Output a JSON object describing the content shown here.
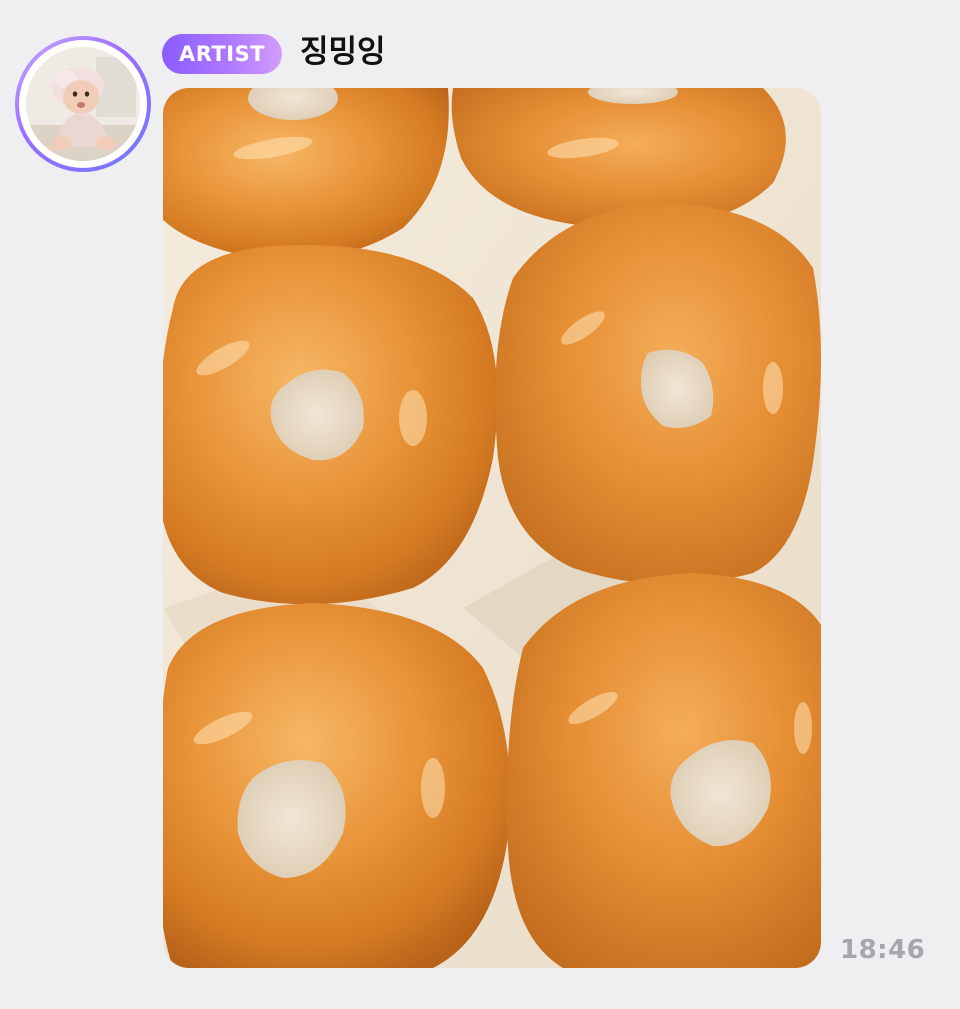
{
  "message": {
    "badge_label": "ARTIST",
    "sender_name": "징밍잉",
    "timestamp": "18:46",
    "avatar": {
      "icon": "baby-photo-avatar"
    },
    "attachment": {
      "type": "photo",
      "subject": "glazed-donuts"
    }
  },
  "colors": {
    "background": "#efeff1",
    "badge_gradient_start": "#8a5cff",
    "badge_gradient_end": "#d39cff",
    "timestamp": "#a7a7ab",
    "name": "#111111"
  }
}
